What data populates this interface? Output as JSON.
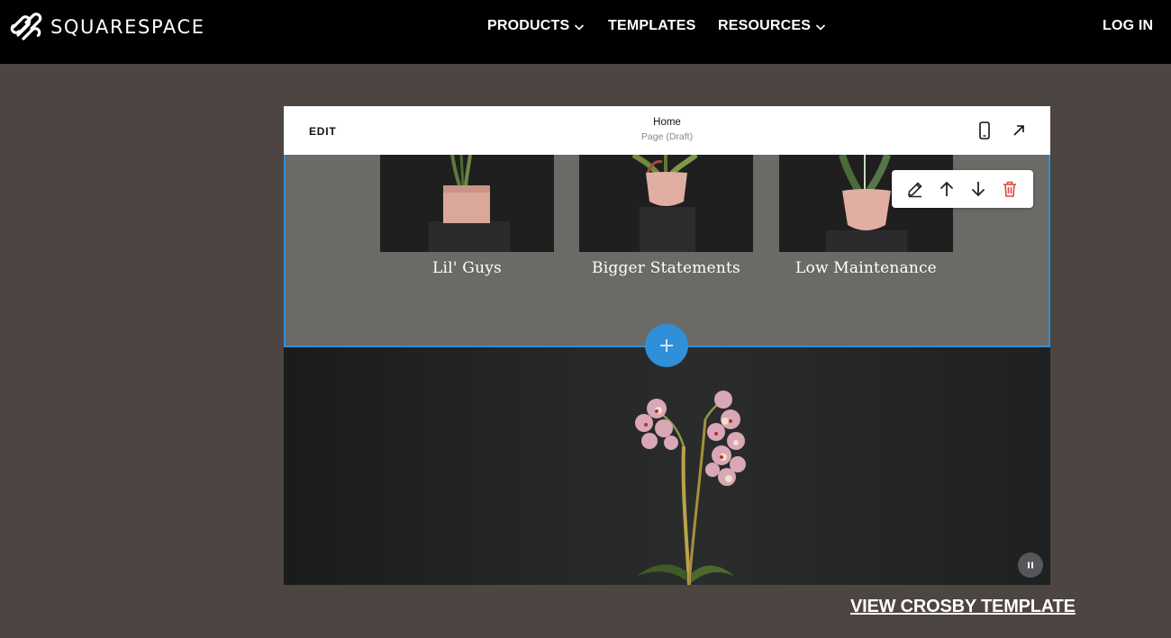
{
  "nav": {
    "brand": "SQUARESPACE",
    "items": [
      {
        "label": "PRODUCTS",
        "has_dropdown": true
      },
      {
        "label": "TEMPLATES",
        "has_dropdown": false
      },
      {
        "label": "RESOURCES",
        "has_dropdown": true
      }
    ],
    "login": "LOG IN"
  },
  "editor": {
    "edit_label": "EDIT",
    "page_title": "Home",
    "page_status": "Page (Draft)",
    "icons": [
      "mobile-preview-icon",
      "expand-icon"
    ]
  },
  "section": {
    "cards": [
      {
        "label": "Lil' Guys"
      },
      {
        "label": "Bigger Statements"
      },
      {
        "label": "Low Maintenance"
      }
    ],
    "toolbar": [
      "pencil-icon",
      "arrow-up-icon",
      "arrow-down-icon",
      "trash-icon"
    ],
    "accent": "#2f8fd9",
    "delete_color": "#e0463a"
  },
  "cta": {
    "view_template": "VIEW CROSBY TEMPLATE"
  },
  "colors": {
    "background": "#4d4542",
    "nav": "#000000",
    "section_bg": "#6b6a67"
  }
}
